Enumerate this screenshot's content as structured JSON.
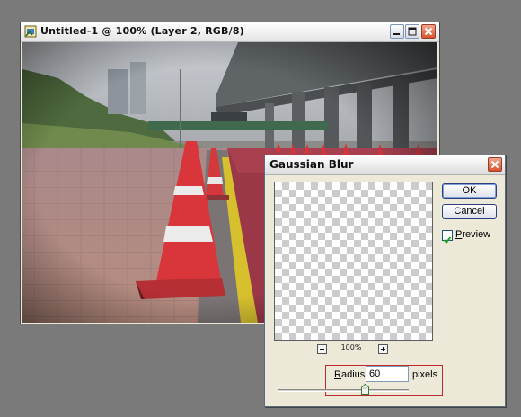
{
  "document_window": {
    "title": "Untitled-1 @ 100% (Layer 2, RGB/8)",
    "controls": [
      "minimize",
      "maximize",
      "close"
    ]
  },
  "canvas_image": {
    "icon": "photo-street-cones"
  },
  "dialog": {
    "title": "Gaussian Blur",
    "ok_label": "OK",
    "cancel_label": "Cancel",
    "preview": {
      "label_underlined": "P",
      "label_rest": "review",
      "checked": true
    },
    "zoom_out": "−",
    "zoom_in": "+",
    "zoom_label": "100%",
    "radius": {
      "label_underlined": "R",
      "label_rest": "adius:",
      "value": "60",
      "unit": "pixels",
      "slider_fraction": 0.65
    }
  },
  "colors": {
    "highlight_border": "#c0272d",
    "desktop": "#7a7a7a"
  }
}
